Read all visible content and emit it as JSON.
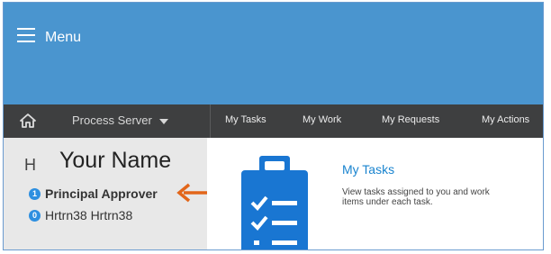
{
  "header": {
    "menu_label": "Menu"
  },
  "nav": {
    "server_label": "Process Server",
    "links": [
      "My Tasks",
      "My Work",
      "My Requests",
      "My Actions"
    ]
  },
  "user_panel": {
    "partial_heading": "H",
    "annotation_text": "Your Name",
    "items": [
      {
        "count": "1",
        "label": "Principal Approver"
      },
      {
        "count": "0",
        "label": "Hrtrn38 Hrtrn38"
      }
    ]
  },
  "tasks_card": {
    "title": "My Tasks",
    "description": "View tasks assigned to you and work items under each task."
  },
  "colors": {
    "menubar": "#4a95cf",
    "navbar": "#3e3f40",
    "accent": "#1a84cf",
    "annotation_arrow": "#e2661a"
  },
  "icons": [
    "hamburger-icon",
    "home-icon",
    "chevron-down-icon",
    "clipboard-checklist-icon",
    "arrow-left-icon"
  ]
}
